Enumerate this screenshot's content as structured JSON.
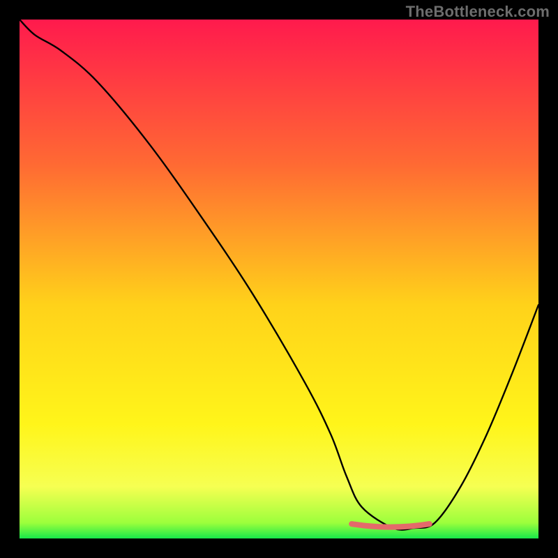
{
  "watermark": "TheBottleneck.com",
  "colors": {
    "page_bg": "#000000",
    "watermark": "#6d6d6d",
    "curve": "#000000",
    "marker": "#e46a6a",
    "gradient_top": "#ff1a4d",
    "gradient_mid1": "#ff7a33",
    "gradient_mid2": "#ffd21a",
    "gradient_mid3": "#fff51a",
    "gradient_mid4": "#f6ff52",
    "gradient_bottom": "#17e84a"
  },
  "chart_data": {
    "type": "line",
    "title": "",
    "xlabel": "",
    "ylabel": "",
    "xlim": [
      0,
      100
    ],
    "ylim": [
      0,
      100
    ],
    "x": [
      0,
      3,
      8,
      15,
      25,
      35,
      45,
      55,
      60,
      63,
      66,
      72,
      76,
      80,
      85,
      90,
      95,
      100
    ],
    "values": [
      100,
      97,
      94,
      88,
      76,
      62,
      47,
      30,
      20,
      12,
      6,
      2,
      2,
      3,
      10,
      20,
      32,
      45
    ],
    "note": "y is 'bottleneck mismatch' percentage; smaller is better (green band near 0). Values are estimated from the plotted curve heights relative to the gradient.",
    "marker": {
      "x_start": 64,
      "x_end": 79,
      "y": 2,
      "description": "highlighted flat-bottom region"
    }
  }
}
